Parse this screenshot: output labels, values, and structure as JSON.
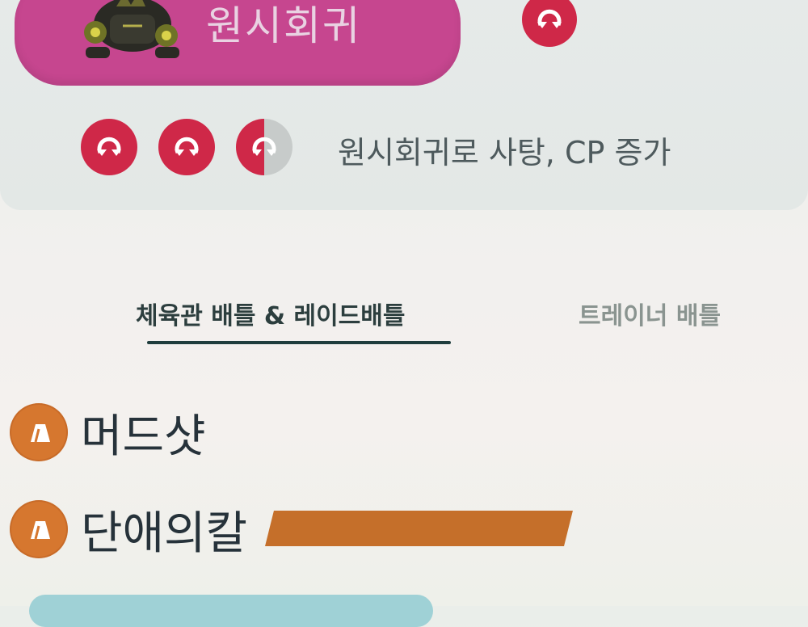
{
  "evolution": {
    "label": "원시회귀",
    "cost_text": "원시회귀로 사탕, CP 증가"
  },
  "tabs": [
    {
      "label": "체육관 배틀 & 레이드배틀",
      "active": true
    },
    {
      "label": "트레이너 배틀",
      "active": false
    }
  ],
  "moves": [
    {
      "name": "머드샷",
      "type_icon": "ground-type-icon"
    },
    {
      "name": "단애의칼",
      "type_icon": "ground-type-icon",
      "energy_bars": 1
    }
  ],
  "colors": {
    "evolution_pill": "#c6468f",
    "reversion_icon": "#cf2848",
    "ground_type": "#d6772f",
    "energy_bar": "#c56f2a",
    "tab_active": "#2c3e3e"
  }
}
